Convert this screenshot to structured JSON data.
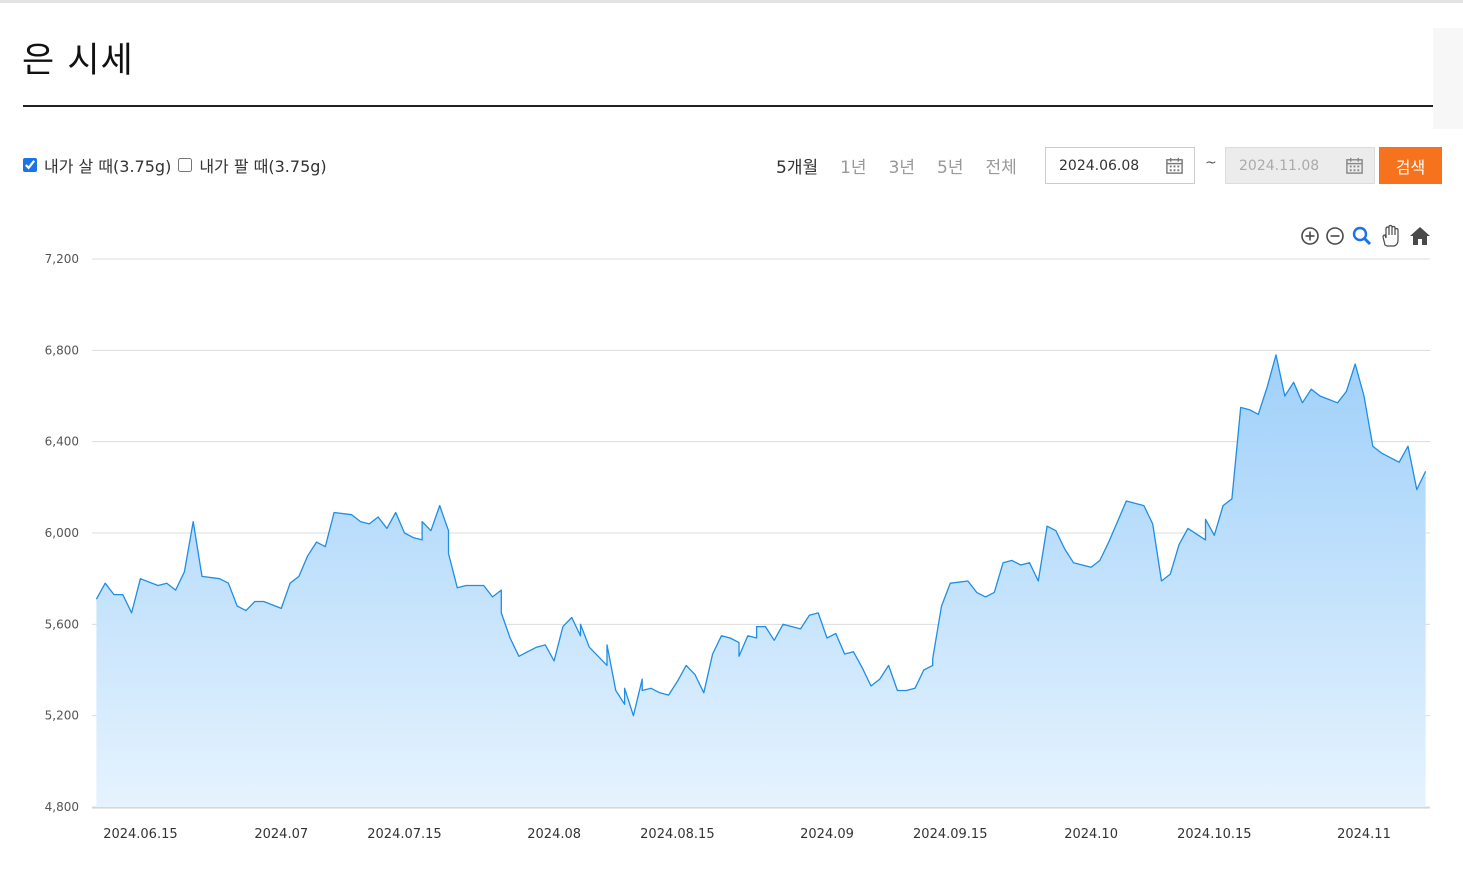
{
  "page": {
    "title": "은 시세"
  },
  "filters": {
    "buy": {
      "label": "내가 살 때(3.75g)",
      "checked": true
    },
    "sell": {
      "label": "내가 팔 때(3.75g)",
      "checked": false
    }
  },
  "periods": [
    "5개월",
    "1년",
    "3년",
    "5년",
    "전체"
  ],
  "active_period": "5개월",
  "date_range": {
    "start": "2024.06.08",
    "end": "2024.11.08",
    "separator": "~"
  },
  "search_label": "검색",
  "toolbar_icons": [
    "zoom-in-icon",
    "zoom-out-icon",
    "magnify-icon",
    "pan-hand-icon",
    "home-icon"
  ],
  "colors": {
    "accent": "#f6721c",
    "line": "#1e8ee6",
    "fill_top": "#9fd0fa",
    "fill_bottom": "#e6f3fe"
  },
  "chart_data": {
    "type": "area",
    "title": "",
    "xlabel": "",
    "ylabel": "",
    "ylim": [
      4800,
      7200
    ],
    "yticks": [
      4800,
      5200,
      5600,
      6000,
      6400,
      6800,
      7200
    ],
    "ytick_labels": [
      "4,800",
      "5,200",
      "5,600",
      "6,000",
      "6,400",
      "6,800",
      "7,200"
    ],
    "xticks": [
      {
        "label": "2024.06.15",
        "x": "2024-06-15"
      },
      {
        "label": "2024.07",
        "x": "2024-07-01"
      },
      {
        "label": "2024.07.15",
        "x": "2024-07-15"
      },
      {
        "label": "2024.08",
        "x": "2024-08-01"
      },
      {
        "label": "2024.08.15",
        "x": "2024-08-15"
      },
      {
        "label": "2024.09",
        "x": "2024-09-01"
      },
      {
        "label": "2024.09.15",
        "x": "2024-09-15"
      },
      {
        "label": "2024.10",
        "x": "2024-10-01"
      },
      {
        "label": "2024.10.15",
        "x": "2024-10-15"
      },
      {
        "label": "2024.11",
        "x": "2024-11-01"
      }
    ],
    "grid": true,
    "series": [
      {
        "points": [
          [
            "2024-06-10",
            5710
          ],
          [
            "2024-06-11",
            5780
          ],
          [
            "2024-06-12",
            5730
          ],
          [
            "2024-06-13",
            5730
          ],
          [
            "2024-06-14",
            5650
          ],
          [
            "2024-06-15",
            5800
          ],
          [
            "2024-06-17",
            5770
          ],
          [
            "2024-06-18",
            5780
          ],
          [
            "2024-06-19",
            5750
          ],
          [
            "2024-06-20",
            5830
          ],
          [
            "2024-06-21",
            6050
          ],
          [
            "2024-06-22",
            5810
          ],
          [
            "2024-06-24",
            5800
          ],
          [
            "2024-06-25",
            5780
          ],
          [
            "2024-06-26",
            5680
          ],
          [
            "2024-06-27",
            5660
          ],
          [
            "2024-06-28",
            5700
          ],
          [
            "2024-06-29",
            5700
          ],
          [
            "2024-07-01",
            5670
          ],
          [
            "2024-07-02",
            5780
          ],
          [
            "2024-07-03",
            5810
          ],
          [
            "2024-07-04",
            5900
          ],
          [
            "2024-07-05",
            5960
          ],
          [
            "2024-07-06",
            5940
          ],
          [
            "2024-07-07",
            6090
          ],
          [
            "2024-07-09",
            6080
          ],
          [
            "2024-07-10",
            6050
          ],
          [
            "2024-07-11",
            6040
          ],
          [
            "2024-07-12",
            6070
          ],
          [
            "2024-07-13",
            6020
          ],
          [
            "2024-07-14",
            6090
          ],
          [
            "2024-07-15",
            6000
          ],
          [
            "2024-07-16",
            5980
          ],
          [
            "2024-07-17",
            5970
          ],
          [
            "2024-07-17",
            6050
          ],
          [
            "2024-07-18",
            6010
          ],
          [
            "2024-07-19",
            6120
          ],
          [
            "2024-07-20",
            6010
          ],
          [
            "2024-07-20",
            5910
          ],
          [
            "2024-07-21",
            5760
          ],
          [
            "2024-07-22",
            5770
          ],
          [
            "2024-07-24",
            5770
          ],
          [
            "2024-07-25",
            5720
          ],
          [
            "2024-07-26",
            5750
          ],
          [
            "2024-07-26",
            5650
          ],
          [
            "2024-07-27",
            5540
          ],
          [
            "2024-07-28",
            5460
          ],
          [
            "2024-07-29",
            5480
          ],
          [
            "2024-07-30",
            5500
          ],
          [
            "2024-07-31",
            5510
          ],
          [
            "2024-08-01",
            5440
          ],
          [
            "2024-08-02",
            5590
          ],
          [
            "2024-08-03",
            5630
          ],
          [
            "2024-08-04",
            5550
          ],
          [
            "2024-08-04",
            5600
          ],
          [
            "2024-08-05",
            5500
          ],
          [
            "2024-08-06",
            5460
          ],
          [
            "2024-08-07",
            5420
          ],
          [
            "2024-08-07",
            5510
          ],
          [
            "2024-08-08",
            5310
          ],
          [
            "2024-08-09",
            5250
          ],
          [
            "2024-08-09",
            5320
          ],
          [
            "2024-08-10",
            5200
          ],
          [
            "2024-08-11",
            5360
          ],
          [
            "2024-08-11",
            5310
          ],
          [
            "2024-08-12",
            5320
          ],
          [
            "2024-08-13",
            5300
          ],
          [
            "2024-08-14",
            5290
          ],
          [
            "2024-08-15",
            5350
          ],
          [
            "2024-08-16",
            5420
          ],
          [
            "2024-08-17",
            5380
          ],
          [
            "2024-08-18",
            5300
          ],
          [
            "2024-08-19",
            5470
          ],
          [
            "2024-08-20",
            5550
          ],
          [
            "2024-08-21",
            5540
          ],
          [
            "2024-08-22",
            5520
          ],
          [
            "2024-08-22",
            5460
          ],
          [
            "2024-08-23",
            5550
          ],
          [
            "2024-08-24",
            5540
          ],
          [
            "2024-08-24",
            5590
          ],
          [
            "2024-08-25",
            5590
          ],
          [
            "2024-08-26",
            5530
          ],
          [
            "2024-08-27",
            5600
          ],
          [
            "2024-08-28",
            5590
          ],
          [
            "2024-08-29",
            5580
          ],
          [
            "2024-08-30",
            5640
          ],
          [
            "2024-08-31",
            5650
          ],
          [
            "2024-09-01",
            5540
          ],
          [
            "2024-09-02",
            5560
          ],
          [
            "2024-09-03",
            5470
          ],
          [
            "2024-09-04",
            5480
          ],
          [
            "2024-09-05",
            5410
          ],
          [
            "2024-09-06",
            5330
          ],
          [
            "2024-09-07",
            5360
          ],
          [
            "2024-09-08",
            5420
          ],
          [
            "2024-09-09",
            5310
          ],
          [
            "2024-09-10",
            5310
          ],
          [
            "2024-09-11",
            5320
          ],
          [
            "2024-09-12",
            5400
          ],
          [
            "2024-09-13",
            5420
          ],
          [
            "2024-09-13",
            5450
          ],
          [
            "2024-09-14",
            5680
          ],
          [
            "2024-09-15",
            5780
          ],
          [
            "2024-09-17",
            5790
          ],
          [
            "2024-09-18",
            5740
          ],
          [
            "2024-09-19",
            5720
          ],
          [
            "2024-09-20",
            5740
          ],
          [
            "2024-09-21",
            5870
          ],
          [
            "2024-09-22",
            5880
          ],
          [
            "2024-09-23",
            5860
          ],
          [
            "2024-09-24",
            5870
          ],
          [
            "2024-09-25",
            5790
          ],
          [
            "2024-09-26",
            6030
          ],
          [
            "2024-09-27",
            6010
          ],
          [
            "2024-09-28",
            5930
          ],
          [
            "2024-09-29",
            5870
          ],
          [
            "2024-09-30",
            5860
          ],
          [
            "2024-10-01",
            5850
          ],
          [
            "2024-10-02",
            5880
          ],
          [
            "2024-10-03",
            5960
          ],
          [
            "2024-10-04",
            6050
          ],
          [
            "2024-10-05",
            6140
          ],
          [
            "2024-10-07",
            6120
          ],
          [
            "2024-10-08",
            6040
          ],
          [
            "2024-10-09",
            5790
          ],
          [
            "2024-10-10",
            5820
          ],
          [
            "2024-10-11",
            5950
          ],
          [
            "2024-10-12",
            6020
          ],
          [
            "2024-10-14",
            5970
          ],
          [
            "2024-10-14",
            6060
          ],
          [
            "2024-10-15",
            5990
          ],
          [
            "2024-10-16",
            6120
          ],
          [
            "2024-10-17",
            6150
          ],
          [
            "2024-10-18",
            6550
          ],
          [
            "2024-10-19",
            6540
          ],
          [
            "2024-10-20",
            6520
          ],
          [
            "2024-10-21",
            6640
          ],
          [
            "2024-10-22",
            6780
          ],
          [
            "2024-10-23",
            6600
          ],
          [
            "2024-10-24",
            6660
          ],
          [
            "2024-10-25",
            6570
          ],
          [
            "2024-10-26",
            6630
          ],
          [
            "2024-10-27",
            6600
          ],
          [
            "2024-10-29",
            6570
          ],
          [
            "2024-10-30",
            6620
          ],
          [
            "2024-10-31",
            6740
          ],
          [
            "2024-11-01",
            6600
          ],
          [
            "2024-11-02",
            6380
          ],
          [
            "2024-11-03",
            6350
          ],
          [
            "2024-11-04",
            6330
          ],
          [
            "2024-11-05",
            6310
          ],
          [
            "2024-11-06",
            6380
          ],
          [
            "2024-11-07",
            6190
          ],
          [
            "2024-11-08",
            6270
          ]
        ]
      }
    ]
  }
}
